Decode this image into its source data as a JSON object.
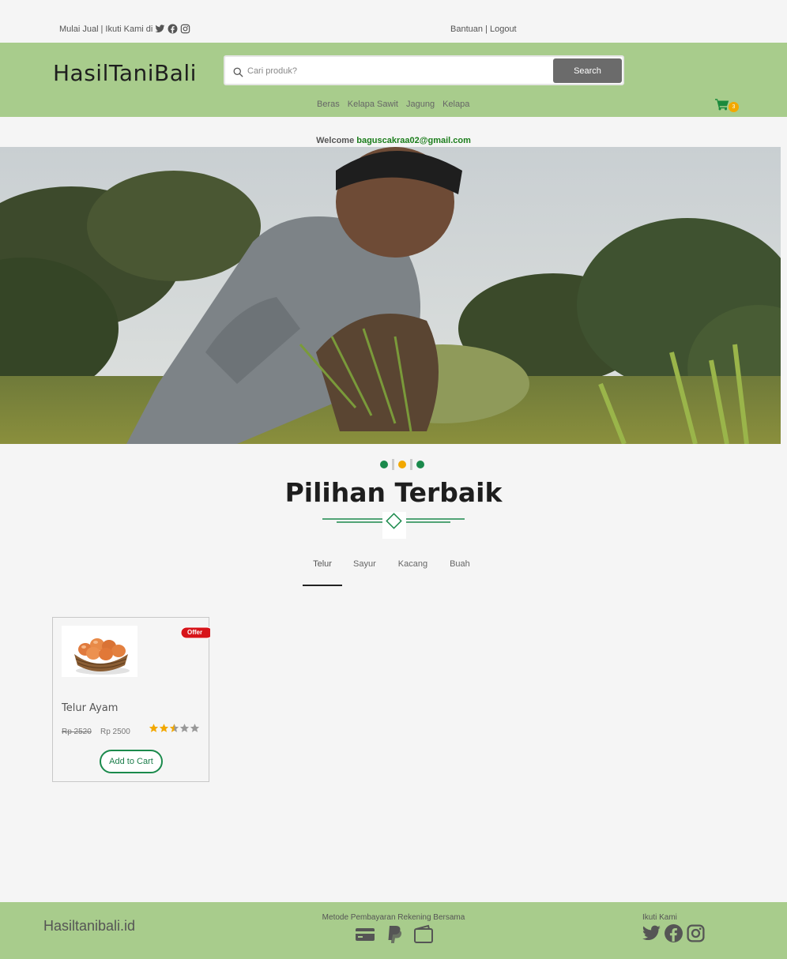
{
  "topbar": {
    "sell_link": "Mulai Jual",
    "separator": "|",
    "follow_text": "Ikuti Kami di",
    "help_link": "Bantuan",
    "logout_link": "Logout",
    "social_icons": [
      "twitter-icon",
      "facebook-icon",
      "instagram-icon"
    ]
  },
  "header": {
    "logo": "HasilTaniBali",
    "search": {
      "placeholder": "Cari produk?",
      "value": "",
      "button_label": "Search"
    },
    "categories": [
      "Beras",
      "Kelapa Sawit",
      "Jagung",
      "Kelapa"
    ],
    "cart": {
      "count": "3",
      "icon": "cart-icon"
    }
  },
  "welcome": {
    "label": "Welcome",
    "email": "baguscakraa02@gmail.com"
  },
  "section": {
    "title": "Pilihan Terbaik",
    "tabs": [
      {
        "label": "Telur",
        "active": true
      },
      {
        "label": "Sayur",
        "active": false
      },
      {
        "label": "Kacang",
        "active": false
      },
      {
        "label": "Buah",
        "active": false
      }
    ]
  },
  "products": [
    {
      "name": "Telur Ayam",
      "badge": "Offer",
      "old_price": "Rp 2520",
      "price": "Rp 2500",
      "rating": 2.5,
      "rating_max": 5,
      "button_label": "Add to Cart"
    }
  ],
  "footer": {
    "brand": "Hasiltanibali.id",
    "payment_label": "Metode Pembayaran Rekening Bersama",
    "payment_icons": [
      "credit-card-icon",
      "paypal-icon",
      "wallet-icon"
    ],
    "follow_label": "Ikuti Kami",
    "social_icons": [
      "twitter-icon",
      "facebook-icon",
      "instagram-icon"
    ]
  },
  "colors": {
    "header_bg": "#a8cc8c",
    "accent_green": "#1b8a4c",
    "accent_orange": "#f2a800",
    "page_bg": "#f5f5f5"
  }
}
